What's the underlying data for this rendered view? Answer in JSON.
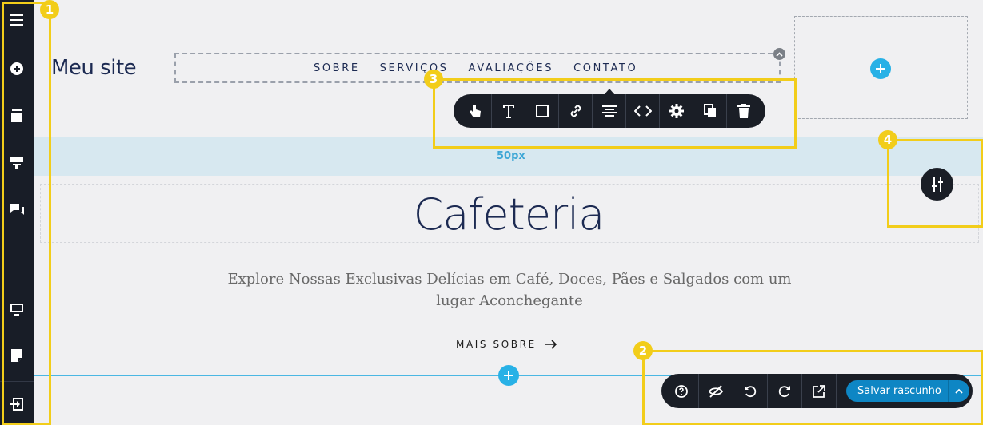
{
  "sidebar": {
    "icons": [
      "menu-icon",
      "add-icon",
      "layers-icon",
      "paint-roller-icon",
      "chat-icon",
      "desktop-icon",
      "page-icon",
      "exit-icon"
    ]
  },
  "header": {
    "brand": "Meu site",
    "menu": [
      "SOBRE",
      "SERVIÇOS",
      "AVALIAÇÕES",
      "CONTATO"
    ]
  },
  "toolbar": {
    "tools": [
      "pointer-icon",
      "text-icon",
      "box-icon",
      "link-icon",
      "align-icon",
      "code-icon",
      "gear-icon",
      "copy-icon",
      "trash-icon"
    ]
  },
  "section": {
    "padding_label": "50px",
    "title": "Cafeteria",
    "subtitle": "Explore Nossas Exclusivas Delícias em Café, Doces, Pães e Salgados com um lugar Aconchegante",
    "cta": "MAIS SOBRE"
  },
  "bottombar": {
    "icons": [
      "help-icon",
      "hide-icon",
      "undo-icon",
      "redo-icon",
      "external-link-icon"
    ],
    "save_label": "Salvar rascunho"
  },
  "callouts": [
    "1",
    "2",
    "3",
    "4"
  ],
  "colors": {
    "sidebar": "#181d27",
    "accent": "#28b1e6",
    "callout": "#f2cd1a",
    "save": "#0e86c4"
  }
}
